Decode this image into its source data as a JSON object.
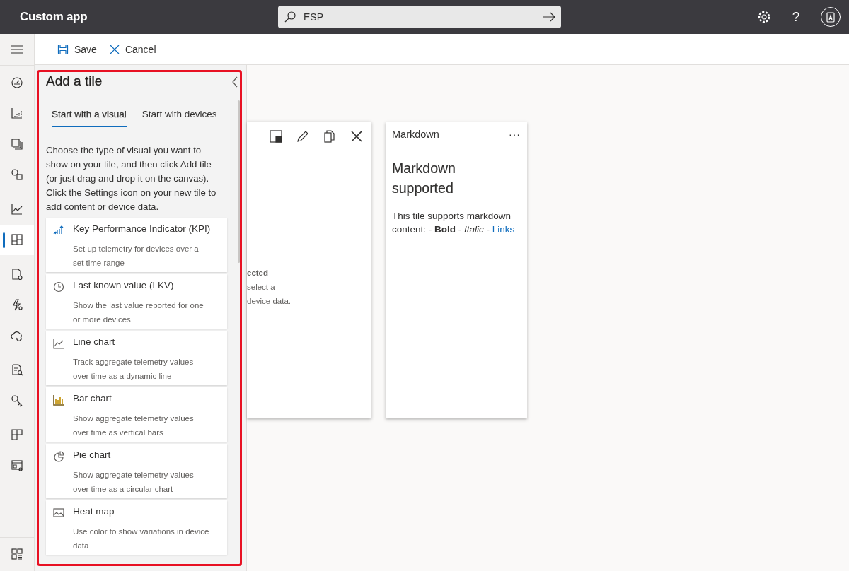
{
  "header": {
    "app_name": "Custom app",
    "search": {
      "value": "ESP"
    },
    "help": "?"
  },
  "command_bar": {
    "buttons": [
      {
        "kind": "save",
        "label": "Save"
      },
      {
        "kind": "cancel",
        "label": "Cancel"
      }
    ]
  },
  "nav_groups": [
    [
      {
        "selected": false
      },
      {
        "selected": false
      },
      {
        "selected": false
      },
      {
        "selected": false
      }
    ],
    [
      {
        "selected": false
      },
      {
        "selected": true
      }
    ],
    [
      {
        "selected": false
      },
      {
        "selected": false
      },
      {
        "selected": false
      }
    ],
    [
      {
        "selected": false
      },
      {
        "selected": false
      }
    ],
    [
      {
        "selected": false
      },
      {
        "selected": false
      }
    ],
    [
      {
        "selected": false
      }
    ]
  ],
  "panel": {
    "title": "Add a tile",
    "tabs": [
      {
        "label": "Start with a visual",
        "selected": true
      },
      {
        "label": "Start with devices",
        "selected": false
      }
    ],
    "description": "Choose the type of visual you want to show on your tile, and then click Add tile (or just drag and drop it on the canvas). Click the Settings icon on your new tile to add content or device data.",
    "tiles": [
      {
        "kind": "kpi",
        "title": "Key Performance Indicator (KPI)",
        "description": "Set up telemetry for devices over a set time range"
      },
      {
        "kind": "lkv",
        "title": "Last known value (LKV)",
        "description": "Show the last value reported for one or more devices"
      },
      {
        "kind": "line",
        "title": "Line chart",
        "description": "Track aggregate telemetry values over time as a dynamic line"
      },
      {
        "kind": "bar",
        "title": "Bar chart",
        "description": "Show aggregate telemetry values over time as vertical bars"
      },
      {
        "kind": "pie",
        "title": "Pie chart",
        "description": "Show aggregate telemetry values over time as a circular chart"
      },
      {
        "kind": "heatmap",
        "title": "Heat map",
        "description": "Use color to show variations in device data"
      }
    ]
  },
  "canvas": {
    "tiles": [
      {
        "kind": "new",
        "heading": "ected",
        "lines": [
          "select a",
          "device data."
        ]
      },
      {
        "kind": "markdown",
        "title": "Markdown",
        "more": "···",
        "heading": "Markdown supported",
        "body": "This tile supports markdown content: - **Bold** - *Italic* -",
        "link": "Links"
      }
    ]
  }
}
